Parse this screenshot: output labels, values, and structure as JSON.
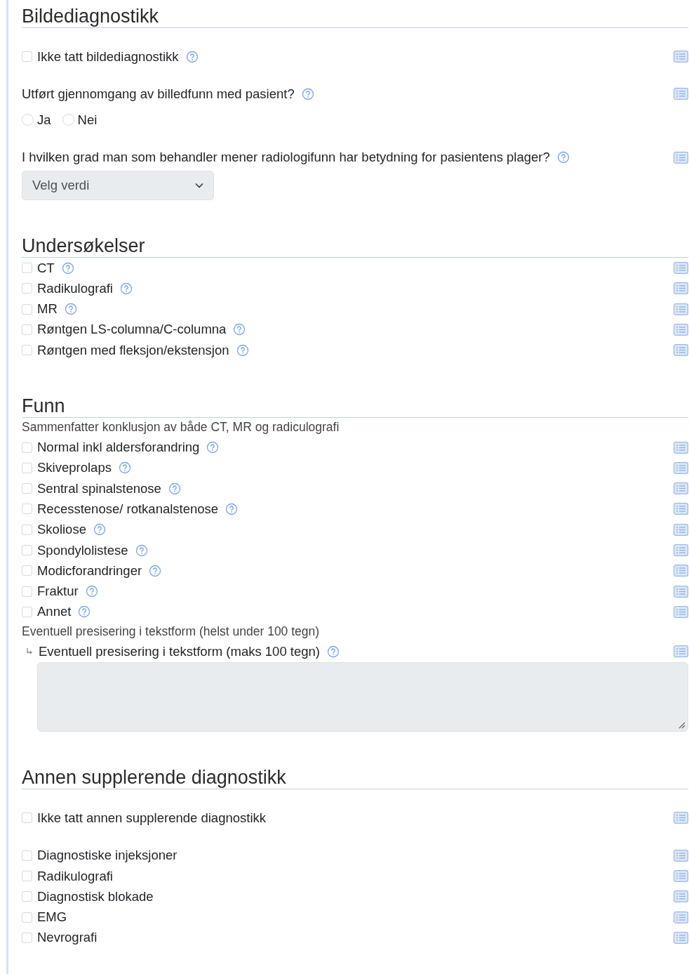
{
  "sections": [
    {
      "title": "Bildediagnostikk",
      "groups": [
        {
          "items": [
            {
              "kind": "checkbox",
              "label": "Ikke tatt bildediagnostikk",
              "checked": false,
              "help": true
            }
          ]
        },
        {
          "items": [
            {
              "kind": "radio",
              "label": "Utført gjennomgang av billedfunn med pasient?",
              "help": true,
              "options": [
                {
                  "label": "Ja",
                  "selected": false
                },
                {
                  "label": "Nei",
                  "selected": false
                }
              ]
            }
          ]
        },
        {
          "items": [
            {
              "kind": "select",
              "label": "I hvilken grad man som behandler mener radiologifunn har betydning for pasientens plager?",
              "help": true,
              "placeholder": "Velg verdi"
            }
          ]
        }
      ]
    },
    {
      "title": "Undersøkelser",
      "groups": [
        {
          "items": [
            {
              "kind": "checkbox",
              "label": "CT",
              "checked": false,
              "help": true
            },
            {
              "kind": "checkbox",
              "label": "Radikulografi",
              "checked": false,
              "help": true
            },
            {
              "kind": "checkbox",
              "label": "MR",
              "checked": false,
              "help": true
            },
            {
              "kind": "checkbox",
              "label": "Røntgen LS-columna/C-columna",
              "checked": false,
              "help": true
            },
            {
              "kind": "checkbox",
              "label": "Røntgen med fleksjon/ekstensjon",
              "checked": false,
              "help": true
            }
          ]
        }
      ]
    },
    {
      "title": "Funn",
      "groups": [
        {
          "items": [
            {
              "kind": "note",
              "text": "Sammenfatter konklusjon av både CT, MR og radiculografi"
            },
            {
              "kind": "checkbox",
              "label": "Normal inkl aldersforandring",
              "checked": false,
              "help": true
            },
            {
              "kind": "checkbox",
              "label": "Skiveprolaps",
              "checked": false,
              "help": true
            },
            {
              "kind": "checkbox",
              "label": "Sentral spinalstenose",
              "checked": false,
              "help": true
            },
            {
              "kind": "checkbox",
              "label": "Recesstenose/ rotkanalstenose",
              "checked": false,
              "help": true
            },
            {
              "kind": "checkbox",
              "label": "Skoliose",
              "checked": false,
              "help": true
            },
            {
              "kind": "checkbox",
              "label": "Spondylolistese",
              "checked": false,
              "help": true
            },
            {
              "kind": "checkbox",
              "label": "Modicforandringer",
              "checked": false,
              "help": true
            },
            {
              "kind": "checkbox",
              "label": "Fraktur",
              "checked": false,
              "help": true
            },
            {
              "kind": "checkbox",
              "label": "Annet",
              "checked": false,
              "help": true
            },
            {
              "kind": "note",
              "text": "Eventuell presisering i tekstform (helst under 100 tegn)"
            },
            {
              "kind": "textarea",
              "label": "Eventuell presisering i tekstform (maks 100 tegn)",
              "help": true
            }
          ]
        }
      ]
    },
    {
      "title": "Annen supplerende diagnostikk",
      "groups": [
        {
          "items": [
            {
              "kind": "checkbox",
              "label": "Ikke tatt annen supplerende diagnostikk",
              "checked": false,
              "help": false
            }
          ]
        },
        {
          "items": [
            {
              "kind": "checkbox",
              "label": "Diagnostiske injeksjoner",
              "checked": false,
              "help": false
            },
            {
              "kind": "checkbox",
              "label": "Radikulografi",
              "checked": false,
              "help": false
            },
            {
              "kind": "checkbox",
              "label": "Diagnostisk blokade",
              "checked": false,
              "help": false
            },
            {
              "kind": "checkbox",
              "label": "EMG",
              "checked": false,
              "help": false
            },
            {
              "kind": "checkbox",
              "label": "Nevrografi",
              "checked": false,
              "help": false
            }
          ]
        }
      ]
    }
  ]
}
